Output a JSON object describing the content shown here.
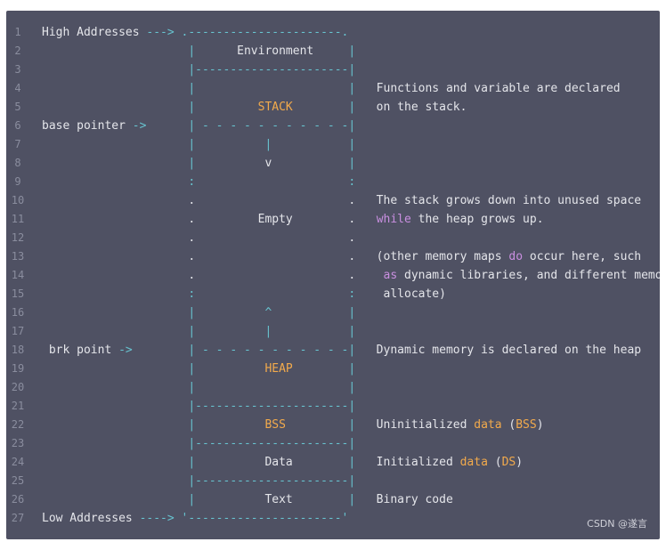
{
  "code": {
    "lines": [
      {
        "n": "1",
        "segments": [
          {
            "t": "High Addresses ",
            "c": "white"
          },
          {
            "t": "--->",
            "c": "cyan"
          },
          {
            "t": " .----------------------.",
            "c": "cyan"
          }
        ]
      },
      {
        "n": "2",
        "segments": [
          {
            "t": "                     |",
            "c": "cyan"
          },
          {
            "t": "      Environment     ",
            "c": "white"
          },
          {
            "t": "|",
            "c": "cyan"
          }
        ]
      },
      {
        "n": "3",
        "segments": [
          {
            "t": "                     |----------------------|",
            "c": "cyan"
          }
        ]
      },
      {
        "n": "4",
        "segments": [
          {
            "t": "                     |                      |",
            "c": "cyan"
          },
          {
            "t": "   Functions and variable are declared",
            "c": "white"
          }
        ]
      },
      {
        "n": "5",
        "segments": [
          {
            "t": "                     |",
            "c": "cyan"
          },
          {
            "t": "         STACK        ",
            "c": "orange"
          },
          {
            "t": "|",
            "c": "cyan"
          },
          {
            "t": "   on the stack.",
            "c": "white"
          }
        ]
      },
      {
        "n": "6",
        "segments": [
          {
            "t": "base pointer ",
            "c": "white"
          },
          {
            "t": "->",
            "c": "cyan"
          },
          {
            "t": "      | - - - - - - - - - - -|",
            "c": "cyan"
          }
        ]
      },
      {
        "n": "7",
        "segments": [
          {
            "t": "                     |          |           |",
            "c": "cyan"
          }
        ]
      },
      {
        "n": "8",
        "segments": [
          {
            "t": "                     |",
            "c": "cyan"
          },
          {
            "t": "          v           ",
            "c": "white"
          },
          {
            "t": "|",
            "c": "cyan"
          }
        ]
      },
      {
        "n": "9",
        "segments": [
          {
            "t": "                     :                      :",
            "c": "cyan"
          }
        ]
      },
      {
        "n": "10",
        "segments": [
          {
            "t": "                     .                      .",
            "c": "white"
          },
          {
            "t": "   The stack grows down into unused space",
            "c": "white"
          }
        ]
      },
      {
        "n": "11",
        "segments": [
          {
            "t": "                     .         Empty        .",
            "c": "white"
          },
          {
            "t": "   ",
            "c": "white"
          },
          {
            "t": "while",
            "c": "purple"
          },
          {
            "t": " the heap grows up.",
            "c": "white"
          }
        ]
      },
      {
        "n": "12",
        "segments": [
          {
            "t": "                     .                      .",
            "c": "white"
          }
        ]
      },
      {
        "n": "13",
        "segments": [
          {
            "t": "                     .                      .",
            "c": "white"
          },
          {
            "t": "   (other memory maps ",
            "c": "white"
          },
          {
            "t": "do",
            "c": "purple"
          },
          {
            "t": " occur here, such",
            "c": "white"
          }
        ]
      },
      {
        "n": "14",
        "segments": [
          {
            "t": "                     .                      .",
            "c": "white"
          },
          {
            "t": "    ",
            "c": "white"
          },
          {
            "t": "as",
            "c": "purple"
          },
          {
            "t": " dynamic libraries, and different memory",
            "c": "white"
          }
        ]
      },
      {
        "n": "15",
        "segments": [
          {
            "t": "                     :                      :",
            "c": "cyan"
          },
          {
            "t": "    allocate)",
            "c": "white"
          }
        ]
      },
      {
        "n": "16",
        "segments": [
          {
            "t": "                     |          ^           |",
            "c": "cyan"
          }
        ]
      },
      {
        "n": "17",
        "segments": [
          {
            "t": "                     |          |           |",
            "c": "cyan"
          }
        ]
      },
      {
        "n": "18",
        "segments": [
          {
            "t": " brk point ",
            "c": "white"
          },
          {
            "t": "->",
            "c": "cyan"
          },
          {
            "t": "        | - - - - - - - - - - -|",
            "c": "cyan"
          },
          {
            "t": "   Dynamic memory is declared on the heap",
            "c": "white"
          }
        ]
      },
      {
        "n": "19",
        "segments": [
          {
            "t": "                     |",
            "c": "cyan"
          },
          {
            "t": "          HEAP        ",
            "c": "orange"
          },
          {
            "t": "|",
            "c": "cyan"
          }
        ]
      },
      {
        "n": "20",
        "segments": [
          {
            "t": "                     |                      |",
            "c": "cyan"
          }
        ]
      },
      {
        "n": "21",
        "segments": [
          {
            "t": "                     |----------------------|",
            "c": "cyan"
          }
        ]
      },
      {
        "n": "22",
        "segments": [
          {
            "t": "                     |",
            "c": "cyan"
          },
          {
            "t": "          BSS         ",
            "c": "orange"
          },
          {
            "t": "|",
            "c": "cyan"
          },
          {
            "t": "   Uninitialized ",
            "c": "white"
          },
          {
            "t": "data",
            "c": "orange"
          },
          {
            "t": " (",
            "c": "white"
          },
          {
            "t": "BSS",
            "c": "orange"
          },
          {
            "t": ")",
            "c": "white"
          }
        ]
      },
      {
        "n": "23",
        "segments": [
          {
            "t": "                     |----------------------|",
            "c": "cyan"
          }
        ]
      },
      {
        "n": "24",
        "segments": [
          {
            "t": "                     |",
            "c": "cyan"
          },
          {
            "t": "          Data        ",
            "c": "white"
          },
          {
            "t": "|",
            "c": "cyan"
          },
          {
            "t": "   Initialized ",
            "c": "white"
          },
          {
            "t": "data",
            "c": "orange"
          },
          {
            "t": " (",
            "c": "white"
          },
          {
            "t": "DS",
            "c": "orange"
          },
          {
            "t": ")",
            "c": "white"
          }
        ]
      },
      {
        "n": "25",
        "segments": [
          {
            "t": "                     |----------------------|",
            "c": "cyan"
          }
        ]
      },
      {
        "n": "26",
        "segments": [
          {
            "t": "                     |",
            "c": "cyan"
          },
          {
            "t": "          Text        ",
            "c": "white"
          },
          {
            "t": "|",
            "c": "cyan"
          },
          {
            "t": "   Binary code",
            "c": "white"
          }
        ]
      },
      {
        "n": "27",
        "segments": [
          {
            "t": "Low Addresses ",
            "c": "white"
          },
          {
            "t": "---->",
            "c": "cyan"
          },
          {
            "t": " '----------------------'",
            "c": "cyan"
          }
        ]
      }
    ]
  },
  "watermark": "CSDN @遂言",
  "colors": {
    "background": "#4f5163",
    "line_number": "#8a8d9e",
    "text": "#e4e5ea",
    "cyan": "#67c3cf",
    "orange": "#f2aa4c",
    "purple": "#c98fe0"
  }
}
